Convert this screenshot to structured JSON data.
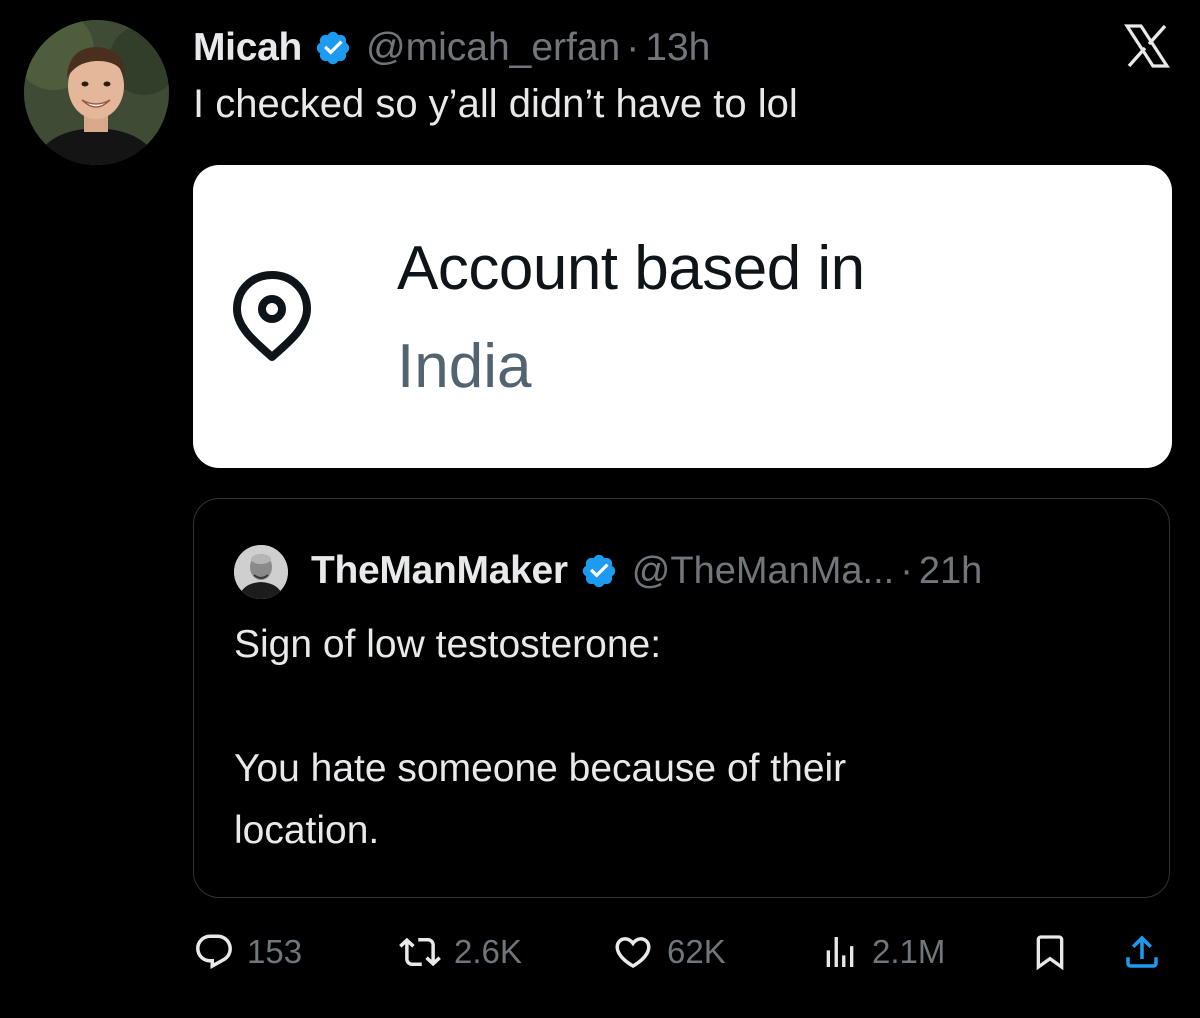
{
  "tweet": {
    "display_name": "Micah",
    "handle": "@micah_erfan",
    "separator": "·",
    "time": "13h",
    "text": "I checked so y’all didn’t have to lol",
    "verified": true
  },
  "location_card": {
    "title": "Account based in",
    "value": "India",
    "icon": "map-pin-icon"
  },
  "quoted_tweet": {
    "display_name": "TheManMaker",
    "handle": "@TheManMa...",
    "separator": "·",
    "time": "21h",
    "verified": true,
    "lines": [
      "Sign of low testosterone:",
      "You hate someone because of their",
      "location."
    ]
  },
  "actions": {
    "replies": "153",
    "reposts": "2.6K",
    "likes": "62K",
    "views": "2.1M"
  },
  "colors": {
    "background": "#000000",
    "primary_text": "#e7e9ea",
    "secondary_text": "#71767b",
    "verified_blue": "#1d9bf0",
    "border": "#2f3336",
    "card_background": "#ffffff",
    "card_title": "#0f1419",
    "card_value": "#536471"
  },
  "icons": [
    "verified-badge-icon",
    "x-logo-icon",
    "map-pin-icon",
    "reply-icon",
    "repost-icon",
    "like-icon",
    "views-icon",
    "bookmark-icon",
    "share-icon"
  ]
}
